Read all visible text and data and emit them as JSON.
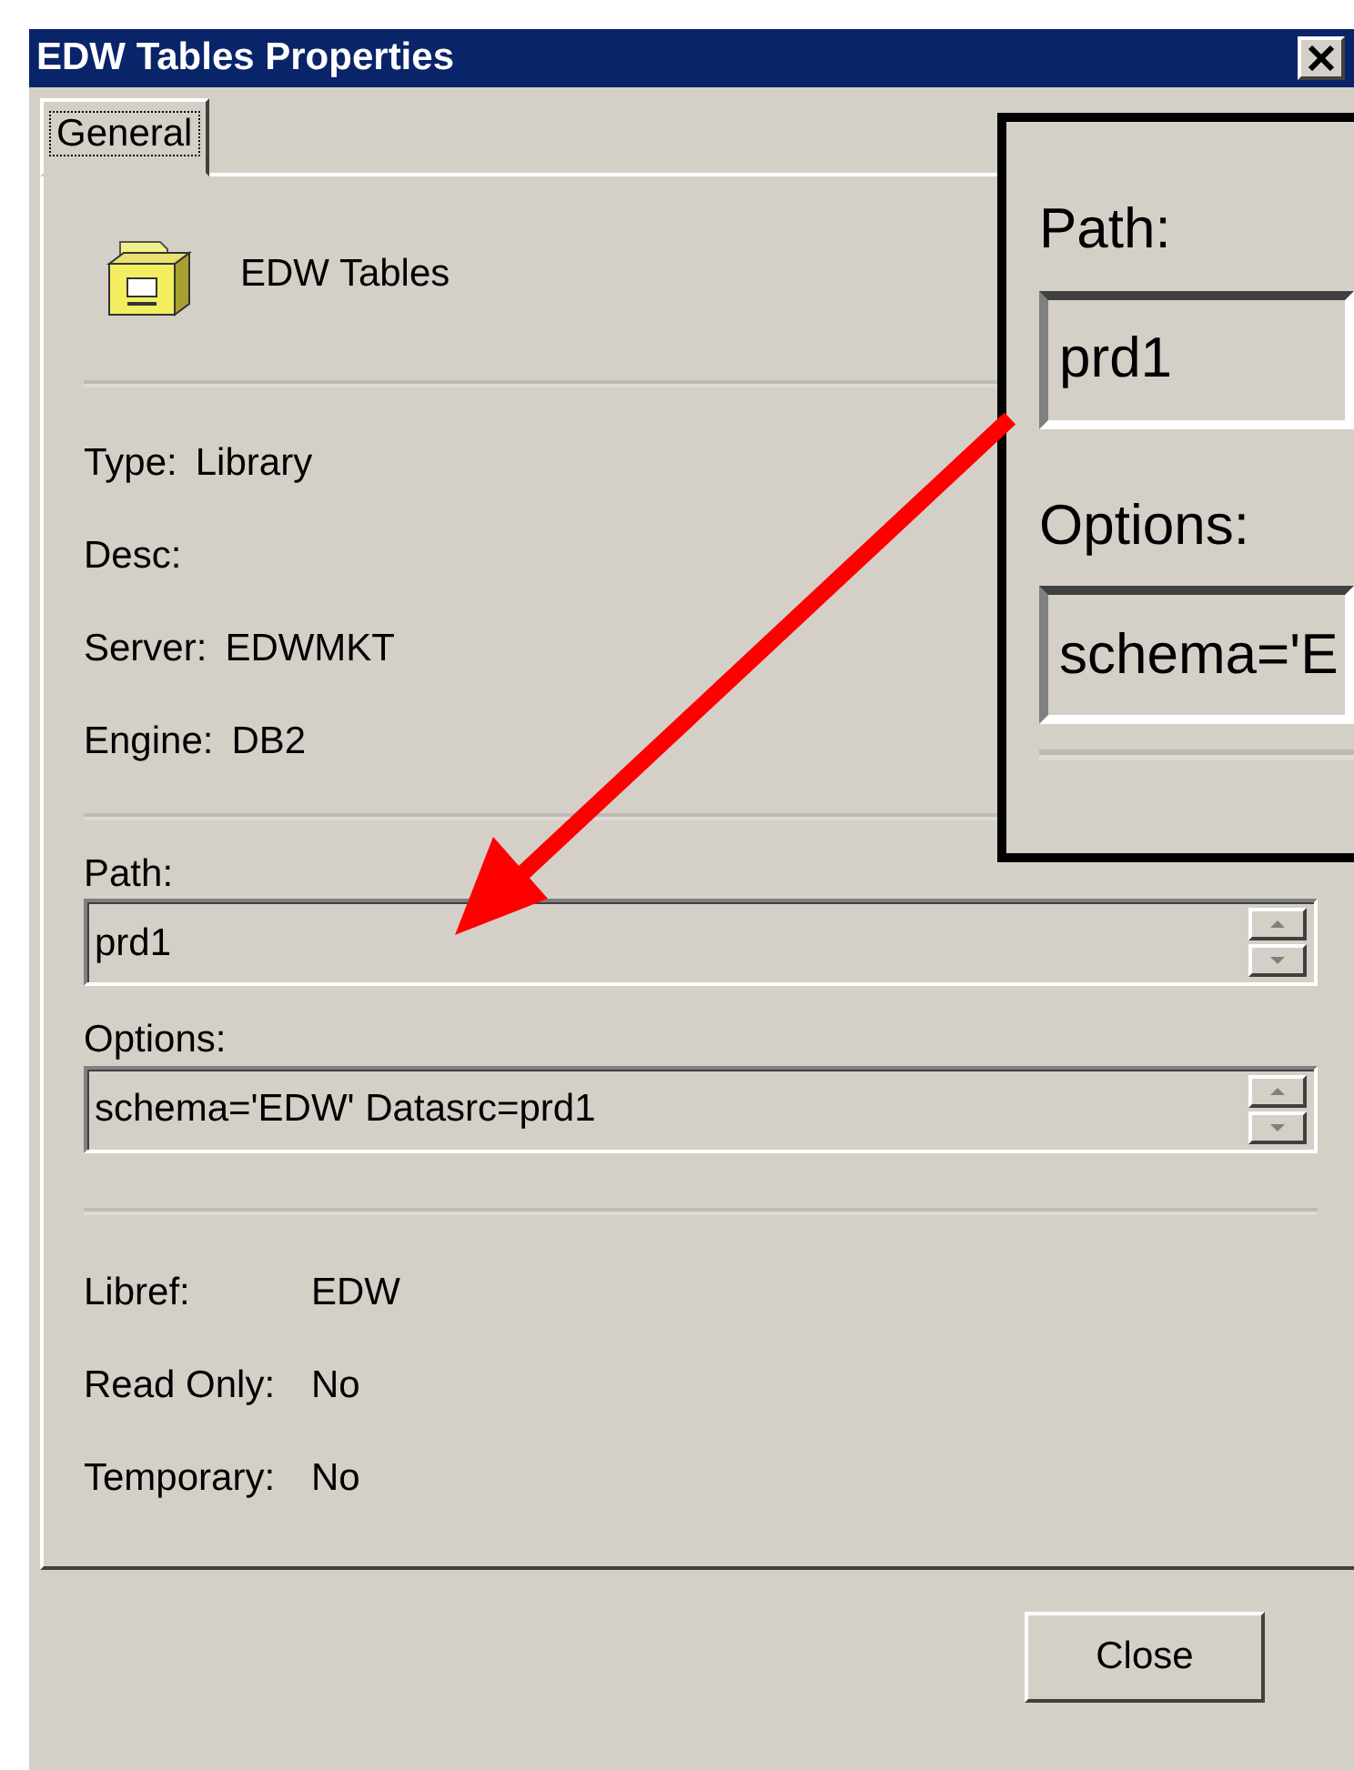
{
  "window": {
    "title": "EDW Tables Properties"
  },
  "tabs": [
    {
      "label": "General",
      "selected": true
    }
  ],
  "header": {
    "name": "EDW Tables"
  },
  "info": [
    {
      "label": "Type:",
      "value": "Library"
    },
    {
      "label": "Desc:"
    },
    {
      "label": "Server:",
      "value": "EDWMKT"
    },
    {
      "label": "Engine:",
      "value": "DB2"
    }
  ],
  "fields": [
    {
      "label": "Path:",
      "value": "prd1"
    },
    {
      "label": "Options:",
      "value": "schema='EDW' Datasrc=prd1"
    }
  ],
  "flags": [
    {
      "label": "Libref:",
      "value": "EDW"
    },
    {
      "label": "Read Only:",
      "value": "No"
    },
    {
      "label": "Temporary:",
      "value": "No"
    }
  ],
  "buttons": [
    "Close"
  ],
  "callout": {
    "fields": [
      {
        "label": "Path:",
        "value": "prd1"
      },
      {
        "label": "Options:",
        "value": "schema='E"
      }
    ]
  }
}
